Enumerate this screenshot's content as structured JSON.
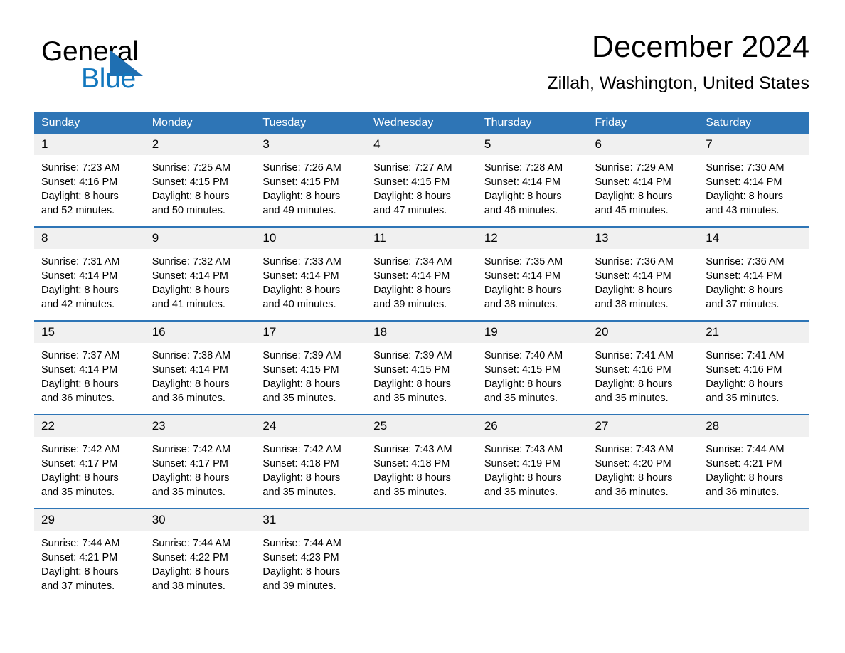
{
  "brand": {
    "name_part1": "General",
    "name_part2": "Blue",
    "triangle_color": "#1F6FB2",
    "blue_color": "#1277BE"
  },
  "header": {
    "title": "December 2024",
    "subtitle": "Zillah, Washington, United States"
  },
  "theme": {
    "header_blue": "#2E75B6",
    "daynum_gray": "#F0F0F0",
    "separator_blue": "#2E75B6"
  },
  "calendar": {
    "weekday_headers": [
      "Sunday",
      "Monday",
      "Tuesday",
      "Wednesday",
      "Thursday",
      "Friday",
      "Saturday"
    ],
    "weeks": [
      [
        {
          "day": "1",
          "sunrise": "Sunrise: 7:23 AM",
          "sunset": "Sunset: 4:16 PM",
          "daylight1": "Daylight: 8 hours",
          "daylight2": "and 52 minutes."
        },
        {
          "day": "2",
          "sunrise": "Sunrise: 7:25 AM",
          "sunset": "Sunset: 4:15 PM",
          "daylight1": "Daylight: 8 hours",
          "daylight2": "and 50 minutes."
        },
        {
          "day": "3",
          "sunrise": "Sunrise: 7:26 AM",
          "sunset": "Sunset: 4:15 PM",
          "daylight1": "Daylight: 8 hours",
          "daylight2": "and 49 minutes."
        },
        {
          "day": "4",
          "sunrise": "Sunrise: 7:27 AM",
          "sunset": "Sunset: 4:15 PM",
          "daylight1": "Daylight: 8 hours",
          "daylight2": "and 47 minutes."
        },
        {
          "day": "5",
          "sunrise": "Sunrise: 7:28 AM",
          "sunset": "Sunset: 4:14 PM",
          "daylight1": "Daylight: 8 hours",
          "daylight2": "and 46 minutes."
        },
        {
          "day": "6",
          "sunrise": "Sunrise: 7:29 AM",
          "sunset": "Sunset: 4:14 PM",
          "daylight1": "Daylight: 8 hours",
          "daylight2": "and 45 minutes."
        },
        {
          "day": "7",
          "sunrise": "Sunrise: 7:30 AM",
          "sunset": "Sunset: 4:14 PM",
          "daylight1": "Daylight: 8 hours",
          "daylight2": "and 43 minutes."
        }
      ],
      [
        {
          "day": "8",
          "sunrise": "Sunrise: 7:31 AM",
          "sunset": "Sunset: 4:14 PM",
          "daylight1": "Daylight: 8 hours",
          "daylight2": "and 42 minutes."
        },
        {
          "day": "9",
          "sunrise": "Sunrise: 7:32 AM",
          "sunset": "Sunset: 4:14 PM",
          "daylight1": "Daylight: 8 hours",
          "daylight2": "and 41 minutes."
        },
        {
          "day": "10",
          "sunrise": "Sunrise: 7:33 AM",
          "sunset": "Sunset: 4:14 PM",
          "daylight1": "Daylight: 8 hours",
          "daylight2": "and 40 minutes."
        },
        {
          "day": "11",
          "sunrise": "Sunrise: 7:34 AM",
          "sunset": "Sunset: 4:14 PM",
          "daylight1": "Daylight: 8 hours",
          "daylight2": "and 39 minutes."
        },
        {
          "day": "12",
          "sunrise": "Sunrise: 7:35 AM",
          "sunset": "Sunset: 4:14 PM",
          "daylight1": "Daylight: 8 hours",
          "daylight2": "and 38 minutes."
        },
        {
          "day": "13",
          "sunrise": "Sunrise: 7:36 AM",
          "sunset": "Sunset: 4:14 PM",
          "daylight1": "Daylight: 8 hours",
          "daylight2": "and 38 minutes."
        },
        {
          "day": "14",
          "sunrise": "Sunrise: 7:36 AM",
          "sunset": "Sunset: 4:14 PM",
          "daylight1": "Daylight: 8 hours",
          "daylight2": "and 37 minutes."
        }
      ],
      [
        {
          "day": "15",
          "sunrise": "Sunrise: 7:37 AM",
          "sunset": "Sunset: 4:14 PM",
          "daylight1": "Daylight: 8 hours",
          "daylight2": "and 36 minutes."
        },
        {
          "day": "16",
          "sunrise": "Sunrise: 7:38 AM",
          "sunset": "Sunset: 4:14 PM",
          "daylight1": "Daylight: 8 hours",
          "daylight2": "and 36 minutes."
        },
        {
          "day": "17",
          "sunrise": "Sunrise: 7:39 AM",
          "sunset": "Sunset: 4:15 PM",
          "daylight1": "Daylight: 8 hours",
          "daylight2": "and 35 minutes."
        },
        {
          "day": "18",
          "sunrise": "Sunrise: 7:39 AM",
          "sunset": "Sunset: 4:15 PM",
          "daylight1": "Daylight: 8 hours",
          "daylight2": "and 35 minutes."
        },
        {
          "day": "19",
          "sunrise": "Sunrise: 7:40 AM",
          "sunset": "Sunset: 4:15 PM",
          "daylight1": "Daylight: 8 hours",
          "daylight2": "and 35 minutes."
        },
        {
          "day": "20",
          "sunrise": "Sunrise: 7:41 AM",
          "sunset": "Sunset: 4:16 PM",
          "daylight1": "Daylight: 8 hours",
          "daylight2": "and 35 minutes."
        },
        {
          "day": "21",
          "sunrise": "Sunrise: 7:41 AM",
          "sunset": "Sunset: 4:16 PM",
          "daylight1": "Daylight: 8 hours",
          "daylight2": "and 35 minutes."
        }
      ],
      [
        {
          "day": "22",
          "sunrise": "Sunrise: 7:42 AM",
          "sunset": "Sunset: 4:17 PM",
          "daylight1": "Daylight: 8 hours",
          "daylight2": "and 35 minutes."
        },
        {
          "day": "23",
          "sunrise": "Sunrise: 7:42 AM",
          "sunset": "Sunset: 4:17 PM",
          "daylight1": "Daylight: 8 hours",
          "daylight2": "and 35 minutes."
        },
        {
          "day": "24",
          "sunrise": "Sunrise: 7:42 AM",
          "sunset": "Sunset: 4:18 PM",
          "daylight1": "Daylight: 8 hours",
          "daylight2": "and 35 minutes."
        },
        {
          "day": "25",
          "sunrise": "Sunrise: 7:43 AM",
          "sunset": "Sunset: 4:18 PM",
          "daylight1": "Daylight: 8 hours",
          "daylight2": "and 35 minutes."
        },
        {
          "day": "26",
          "sunrise": "Sunrise: 7:43 AM",
          "sunset": "Sunset: 4:19 PM",
          "daylight1": "Daylight: 8 hours",
          "daylight2": "and 35 minutes."
        },
        {
          "day": "27",
          "sunrise": "Sunrise: 7:43 AM",
          "sunset": "Sunset: 4:20 PM",
          "daylight1": "Daylight: 8 hours",
          "daylight2": "and 36 minutes."
        },
        {
          "day": "28",
          "sunrise": "Sunrise: 7:44 AM",
          "sunset": "Sunset: 4:21 PM",
          "daylight1": "Daylight: 8 hours",
          "daylight2": "and 36 minutes."
        }
      ],
      [
        {
          "day": "29",
          "sunrise": "Sunrise: 7:44 AM",
          "sunset": "Sunset: 4:21 PM",
          "daylight1": "Daylight: 8 hours",
          "daylight2": "and 37 minutes."
        },
        {
          "day": "30",
          "sunrise": "Sunrise: 7:44 AM",
          "sunset": "Sunset: 4:22 PM",
          "daylight1": "Daylight: 8 hours",
          "daylight2": "and 38 minutes."
        },
        {
          "day": "31",
          "sunrise": "Sunrise: 7:44 AM",
          "sunset": "Sunset: 4:23 PM",
          "daylight1": "Daylight: 8 hours",
          "daylight2": "and 39 minutes."
        },
        {
          "day": "",
          "sunrise": "",
          "sunset": "",
          "daylight1": "",
          "daylight2": ""
        },
        {
          "day": "",
          "sunrise": "",
          "sunset": "",
          "daylight1": "",
          "daylight2": ""
        },
        {
          "day": "",
          "sunrise": "",
          "sunset": "",
          "daylight1": "",
          "daylight2": ""
        },
        {
          "day": "",
          "sunrise": "",
          "sunset": "",
          "daylight1": "",
          "daylight2": ""
        }
      ]
    ]
  }
}
